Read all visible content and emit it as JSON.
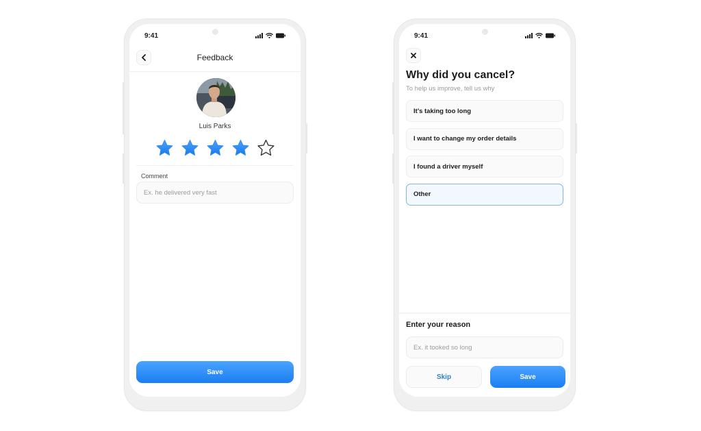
{
  "colors": {
    "accent": "#1a7ef2",
    "star_filled": "#2f8cf0",
    "selected_border": "#7fb8de",
    "skip_text": "#2f7fc8"
  },
  "feedback_screen": {
    "status_bar": {
      "time": "9:41",
      "icons": [
        "signal-icon",
        "wifi-icon",
        "battery-icon"
      ]
    },
    "header": {
      "back_icon": "chevron-left-icon",
      "title": "Feedback"
    },
    "user": {
      "name": "Luis Parks",
      "avatar": "avatar-photo"
    },
    "rating": {
      "value": 4,
      "max": 5
    },
    "comment": {
      "label": "Comment",
      "placeholder": "Ex. he delivered very fast",
      "value": ""
    },
    "save_label": "Save"
  },
  "cancel_screen": {
    "status_bar": {
      "time": "9:41",
      "icons": [
        "signal-icon",
        "wifi-icon",
        "battery-icon"
      ]
    },
    "close_icon": "close-icon",
    "title": "Why did you cancel?",
    "subtitle": "To help us improve, tell us why",
    "options": [
      {
        "label": "It’s taking too long",
        "selected": false
      },
      {
        "label": "I want to change my order details",
        "selected": false
      },
      {
        "label": "I found a driver myself",
        "selected": false
      },
      {
        "label": "Other",
        "selected": true
      }
    ],
    "reason": {
      "label": "Enter your reason",
      "placeholder": "Ex. it tooked so long",
      "value": ""
    },
    "skip_label": "Skip",
    "save_label": "Save"
  }
}
